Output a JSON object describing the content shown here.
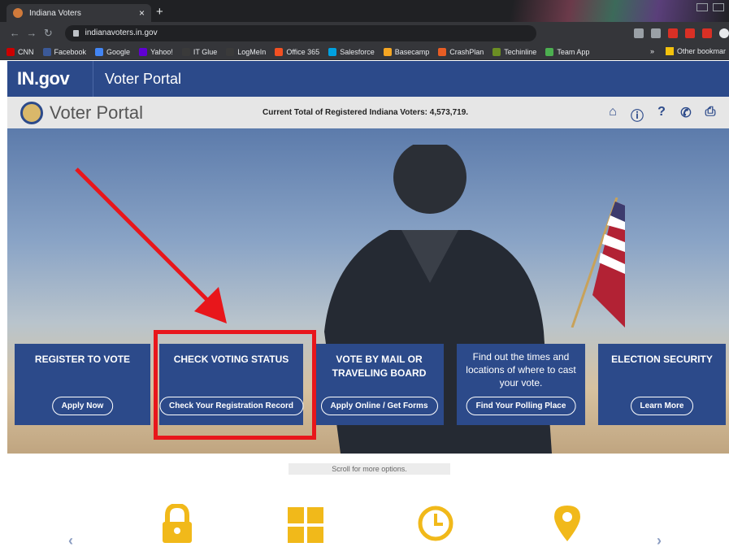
{
  "browser": {
    "tab_title": "Indiana Voters",
    "tab_close": "×",
    "new_tab": "+",
    "url": "indianavoters.in.gov",
    "bookmarks": [
      {
        "label": "CNN",
        "color": "#cc0000"
      },
      {
        "label": "Facebook",
        "color": "#3b5998"
      },
      {
        "label": "Google",
        "color": "#4285f4"
      },
      {
        "label": "Yahoo!",
        "color": "#6001d2"
      },
      {
        "label": "IT Glue",
        "color": "#3a3a3a"
      },
      {
        "label": "LogMeIn",
        "color": "#3a3a3a"
      },
      {
        "label": "Office 365",
        "color": "#f25022"
      },
      {
        "label": "Salesforce",
        "color": "#00a1e0"
      },
      {
        "label": "Basecamp",
        "color": "#f5a623"
      },
      {
        "label": "CrashPlan",
        "color": "#e85d24"
      },
      {
        "label": "Techinline",
        "color": "#6b8e23"
      },
      {
        "label": "Team App",
        "color": "#4caf50"
      }
    ],
    "bookmarks_overflow": "»",
    "other_bookmarks": "Other bookmar"
  },
  "site": {
    "gov_logo": "IN.gov",
    "portal_label": "Voter Portal",
    "sub_title": "Voter Portal",
    "voter_count_text": "Current Total of Registered Indiana Voters: 4,573,719.",
    "header_icons": [
      "home-icon",
      "info-icon",
      "help-icon",
      "phone-icon",
      "print-icon"
    ],
    "accent_color": "#2c4a8a"
  },
  "cards": [
    {
      "title": "REGISTER TO VOTE",
      "text": "",
      "button": "Apply Now"
    },
    {
      "title": "CHECK VOTING STATUS",
      "text": "",
      "button": "Check Your Registration Record"
    },
    {
      "title": "VOTE BY MAIL OR TRAVELING BOARD",
      "text": "",
      "button": "Apply Online / Get Forms"
    },
    {
      "title": "",
      "text": "Find out the times and locations of where to cast your vote.",
      "button": "Find Your Polling Place"
    },
    {
      "title": "ELECTION SECURITY",
      "text": "",
      "button": "Learn More"
    }
  ],
  "scroll_hint": "Scroll for more options.",
  "feature_icons": [
    "lock-icon",
    "grid-icon",
    "clock-icon",
    "location-pin-icon"
  ],
  "highlight_color": "#e8161b"
}
